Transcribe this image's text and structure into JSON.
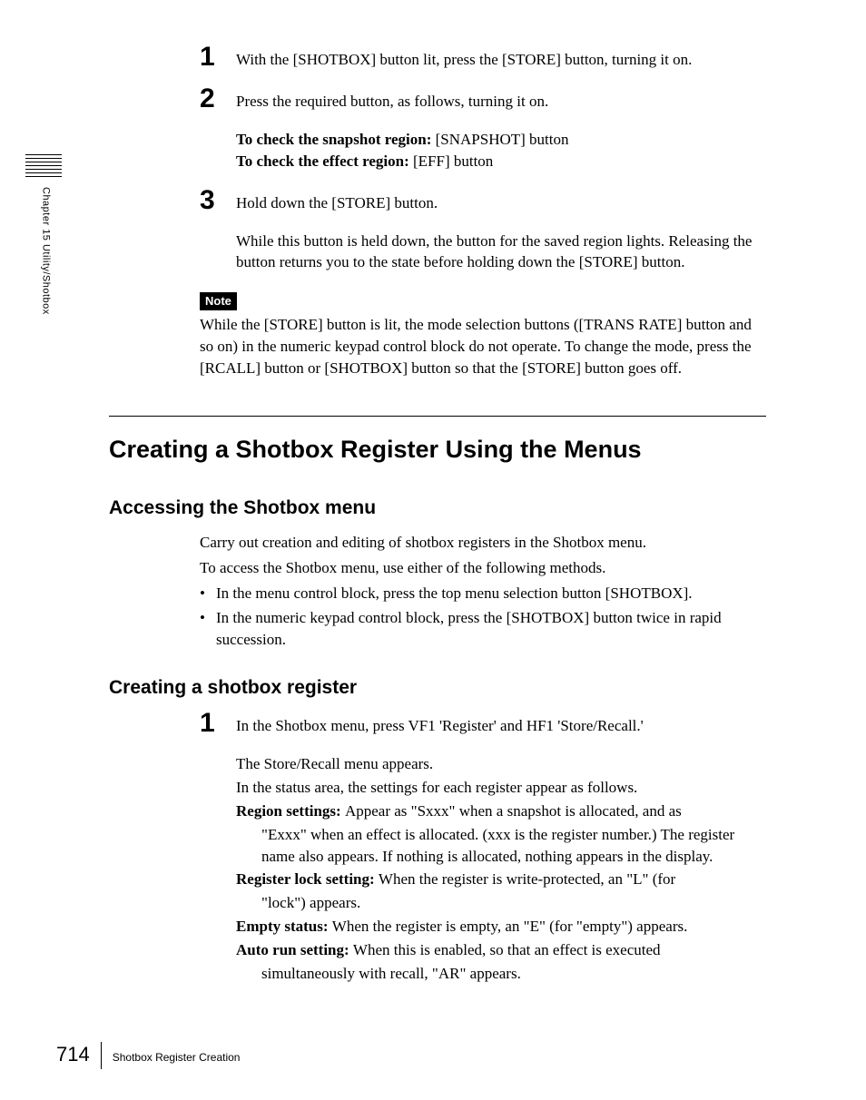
{
  "sidebar": {
    "chapter_label": "Chapter 15   Utility/Shotbox"
  },
  "steps_top": [
    {
      "num": "1",
      "text": "With the [SHOTBOX] button lit, press the [STORE] button, turning it on."
    },
    {
      "num": "2",
      "text": "Press the required button, as follows, turning it on."
    }
  ],
  "check_lines": [
    {
      "label": "To check the snapshot region: ",
      "value": "[SNAPSHOT] button"
    },
    {
      "label": "To check the effect region: ",
      "value": "[EFF] button"
    }
  ],
  "step3": {
    "num": "3",
    "text": "Hold down the [STORE] button."
  },
  "step3_after": "While this button is held down, the button for the saved region lights. Releasing the button returns you to the state before holding down the [STORE] button.",
  "note": {
    "label": "Note",
    "text": "While the [STORE] button is lit, the mode selection buttons ([TRANS RATE] button and so on) in the numeric keypad control block do not operate. To change the mode, press the [RCALL] button or [SHOTBOX] button so that the [STORE] button goes off."
  },
  "h1": "Creating a Shotbox Register Using the Menus",
  "section1": {
    "h2": "Accessing the Shotbox menu",
    "p1": "Carry out creation and editing of shotbox registers in the Shotbox menu.",
    "p2": "To access the Shotbox menu, use either of the following methods.",
    "bullets": [
      "In the menu control block, press the top menu selection button [SHOTBOX].",
      "In the numeric keypad control block, press the [SHOTBOX] button twice in rapid succession."
    ]
  },
  "section2": {
    "h2": "Creating a shotbox register",
    "step": {
      "num": "1",
      "text": "In the Shotbox menu, press VF1 'Register' and HF1 'Store/Recall.'"
    },
    "after1": "The Store/Recall menu appears.",
    "after2": "In the status area, the settings for each register appear as follows.",
    "defs": [
      {
        "label": "Region settings: ",
        "text": "Appear as \"Sxxx\" when a snapshot is allocated, and as",
        "cont": [
          "\"Exxx\" when an effect is allocated. (xxx is the register number.) The register name also appears. If nothing is allocated, nothing appears in the display."
        ]
      },
      {
        "label": "Register lock setting: ",
        "text": "When the register is write-protected, an \"L\" (for",
        "cont": [
          "\"lock\") appears."
        ]
      },
      {
        "label": "Empty status: ",
        "text": "When the register is empty, an \"E\" (for \"empty\") appears.",
        "cont": []
      },
      {
        "label": "Auto run setting: ",
        "text": "When this is enabled, so that an effect is executed",
        "cont": [
          "simultaneously with recall, \"AR\" appears."
        ]
      }
    ]
  },
  "footer": {
    "page": "714",
    "title": "Shotbox Register Creation"
  }
}
